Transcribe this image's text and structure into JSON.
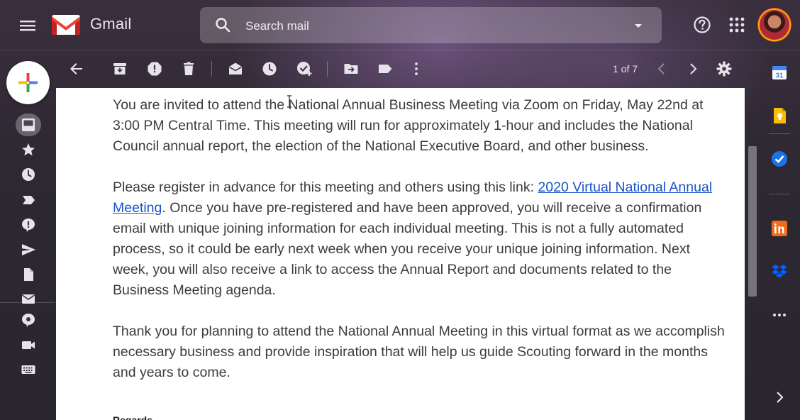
{
  "app": {
    "brand": "Gmail"
  },
  "search": {
    "placeholder": "Search mail"
  },
  "toolbar": {
    "page_count": "1 of 7"
  },
  "message": {
    "paragraphs": {
      "p1": "You are invited to attend the National Annual Business Meeting via Zoom on Friday, May 22nd at 3:00 PM Central Time. This meeting will run for approximately 1-hour and includes the National Council annual report, the election of the National Executive Board, and other business.",
      "p2_before": "Please register in advance for this meeting and others using this link: ",
      "p2_link": "2020 Virtual National Annual Meeting",
      "p2_after": ". Once you have pre-registered and have been approved, you will receive a confirmation email with unique joining information for each individual meeting. This is not a fully automated process, so it could be early next week when you receive your unique joining information. Next week, you will also receive a link to access the Annual Report and documents related to the Business Meeting agenda.",
      "p3": "Thank you for planning to attend the National Annual Meeting in this virtual format as we accomplish necessary business and provide inspiration that will help us guide Scouting forward in the months and years to come."
    },
    "closing": "Regards"
  },
  "side_panel": {
    "calendar_day": "31"
  },
  "colors": {
    "link": "#1a55c4",
    "body_text": "#3c3c3c",
    "icon": "#e6e3ea",
    "gmail_red": "#EA4335"
  },
  "icons": {
    "top": [
      "menu-icon",
      "gmail-logo",
      "search-icon",
      "chevron-down-icon",
      "help-icon",
      "apps-grid-icon"
    ],
    "rail": [
      "inbox-icon",
      "star-icon",
      "clock-icon",
      "label-icon",
      "chat-bubble-icon",
      "send-icon",
      "file-icon",
      "mail-icon",
      "message-icon",
      "video-icon",
      "keyboard-icon"
    ],
    "toolbar": [
      "back-arrow-icon",
      "archive-icon",
      "report-spam-icon",
      "trash-icon",
      "mark-unread-icon",
      "snooze-icon",
      "add-task-icon",
      "move-to-icon",
      "label-icon",
      "more-vert-icon",
      "chevron-left-icon",
      "chevron-right-icon",
      "settings-gear-icon"
    ],
    "side": [
      "calendar-icon",
      "keep-icon",
      "tasks-icon",
      "invoice-app-icon",
      "dropbox-icon",
      "more-horiz-icon",
      "chevron-right-icon"
    ]
  }
}
